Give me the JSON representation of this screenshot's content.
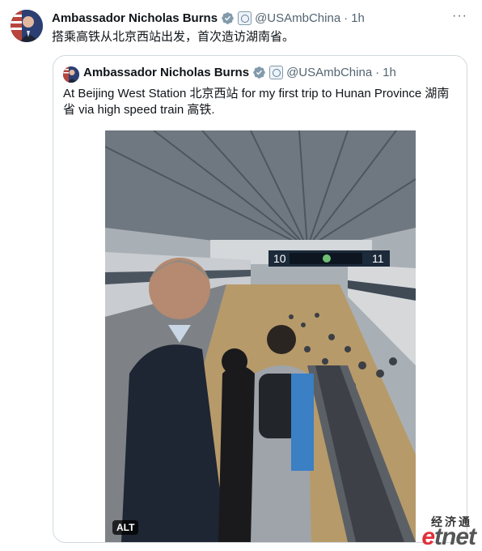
{
  "tweet": {
    "author_name": "Ambassador Nicholas Burns",
    "handle": "@USAmbChina",
    "separator": "·",
    "time": "1h",
    "more": "···",
    "text": "搭乘高铁从北京西站出发，首次造访湖南省。"
  },
  "quote": {
    "author_name": "Ambassador Nicholas Burns",
    "handle": "@USAmbChina",
    "separator": "·",
    "time": "1h",
    "text": "At Beijing West Station 北京西站 for my first trip to Hunan Province 湖南省 via high speed train 高铁.",
    "media": {
      "alt_badge": "ALT",
      "platform_left": "10",
      "platform_right": "11"
    }
  },
  "watermark": {
    "chinese": "经济通",
    "logo_e": "e",
    "logo_rest": "tnet"
  },
  "colors": {
    "verified": "#829aab",
    "text": "#0f1419",
    "secondary": "#536471",
    "border": "#cfd9de",
    "etnet_red": "#e0313b"
  },
  "icons": [
    "verified-badge-icon",
    "government-badge-icon",
    "more-options-icon"
  ]
}
